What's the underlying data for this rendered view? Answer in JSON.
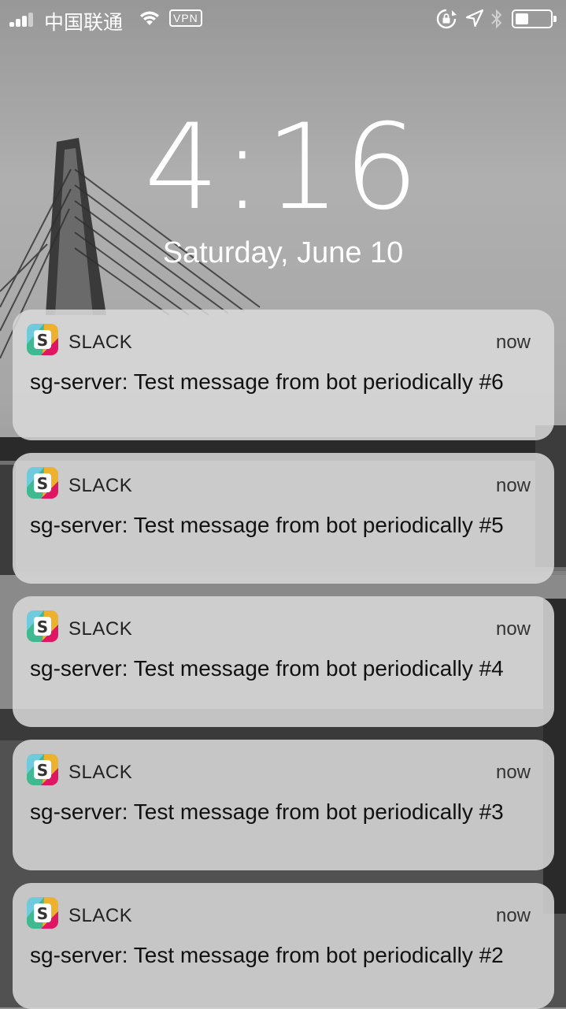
{
  "status_bar": {
    "carrier": "中国联通",
    "vpn_label": "VPN",
    "battery_level": 0.38
  },
  "lock_screen": {
    "time": "4:16",
    "date": "Saturday, June 10"
  },
  "notifications": [
    {
      "app": "SLACK",
      "time": "now",
      "message": "sg-server: Test message from bot periodically #6"
    },
    {
      "app": "SLACK",
      "time": "now",
      "message": "sg-server: Test message from bot periodically #5"
    },
    {
      "app": "SLACK",
      "time": "now",
      "message": "sg-server: Test message from bot periodically #4"
    },
    {
      "app": "SLACK",
      "time": "now",
      "message": "sg-server: Test message from bot periodically #3"
    },
    {
      "app": "SLACK",
      "time": "now",
      "message": "sg-server: Test message from bot periodically #2"
    }
  ],
  "colors": {
    "slack_teal": "#3EB991",
    "slack_yellow": "#ECB22E",
    "slack_pink": "#E01563",
    "slack_blue": "#6ECADC"
  }
}
